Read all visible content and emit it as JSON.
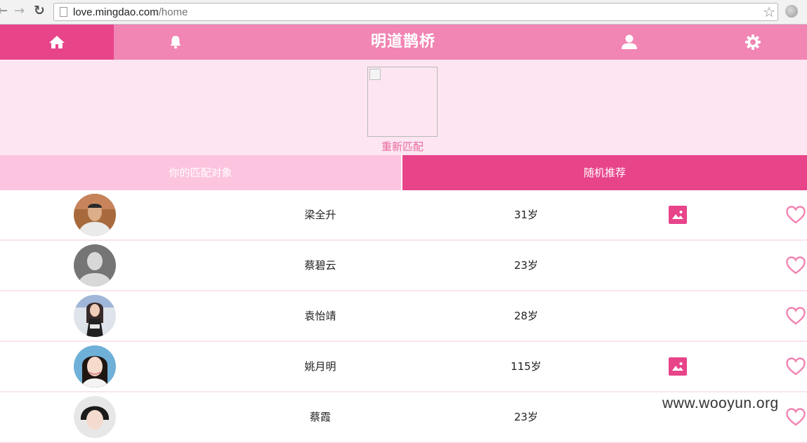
{
  "browser": {
    "url_host": "love.mingdao.com",
    "url_path": "/home"
  },
  "app": {
    "title": "明道鹊桥",
    "nav": [
      "home-icon",
      "bell-icon",
      "user-icon",
      "gear-icon"
    ],
    "accent": "#e8448a",
    "nav_bg": "#f185b3"
  },
  "banner": {
    "rematch_label": "重新匹配"
  },
  "tabs": {
    "match_label": "你的匹配对象",
    "random_label": "随机推荐"
  },
  "users": [
    {
      "name": "梁全升",
      "age": "31岁",
      "has_photos": true
    },
    {
      "name": "蔡碧云",
      "age": "23岁",
      "has_photos": false
    },
    {
      "name": "袁怡靖",
      "age": "28岁",
      "has_photos": false
    },
    {
      "name": "姚月明",
      "age": "115岁",
      "has_photos": true
    },
    {
      "name": "蔡霞",
      "age": "23岁",
      "has_photos": false
    }
  ],
  "watermark": "www.wooyun.org"
}
